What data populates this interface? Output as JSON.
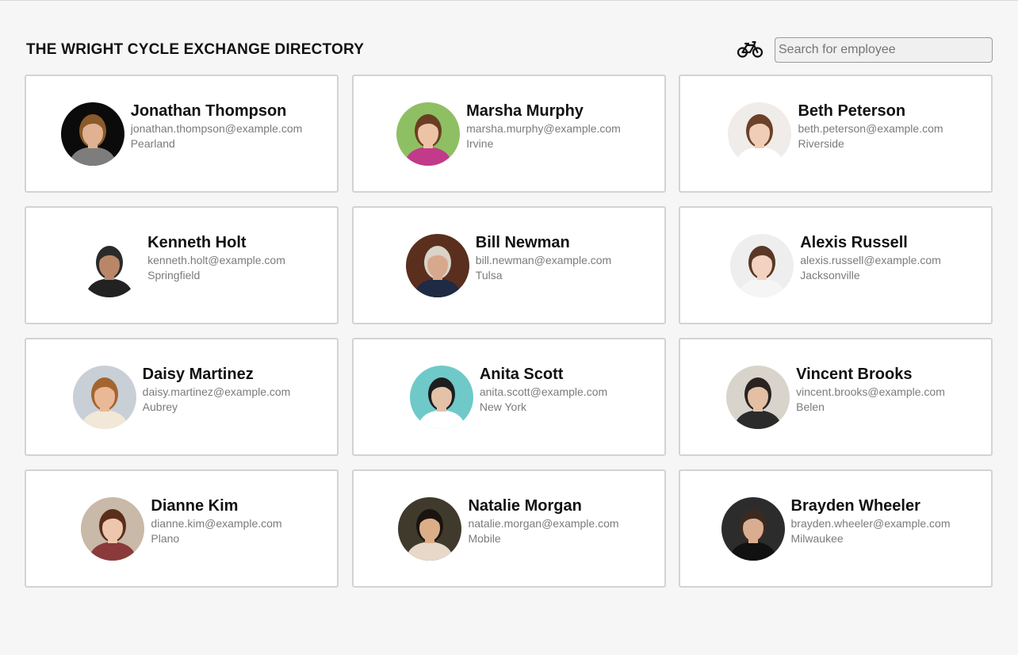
{
  "header": {
    "title": "THE WRIGHT CYCLE EXCHANGE DIRECTORY",
    "logo_icon": "bicycle-icon",
    "search_placeholder": "Search for employee",
    "search_value": ""
  },
  "colors": {
    "background": "#f6f6f6",
    "card_border": "#d3d3d3",
    "secondary_text": "#7b7b7b"
  },
  "employees": [
    {
      "name": "Jonathan Thompson",
      "email": "jonathan.thompson@example.com",
      "city": "Pearland",
      "avatar": {
        "bg": "#0b0b0b",
        "skin": "#e0b291",
        "hair": "#8a5a2b",
        "shirt": "#7d7d7d"
      }
    },
    {
      "name": "Marsha Murphy",
      "email": "marsha.murphy@example.com",
      "city": "Irvine",
      "avatar": {
        "bg": "#8fbf63",
        "skin": "#edc3a5",
        "hair": "#6a3e22",
        "shirt": "#c23a8a"
      }
    },
    {
      "name": "Beth Peterson",
      "email": "beth.peterson@example.com",
      "city": "Riverside",
      "avatar": {
        "bg": "#f0ecea",
        "skin": "#efcdb7",
        "hair": "#6b4128",
        "shirt": "#ffffff"
      }
    },
    {
      "name": "Kenneth Holt",
      "email": "kenneth.holt@example.com",
      "city": "Springfield",
      "avatar": {
        "bg": "#ffffff",
        "skin": "#b98767",
        "hair": "#2a2a2a",
        "shirt": "#222222"
      }
    },
    {
      "name": "Bill Newman",
      "email": "bill.newman@example.com",
      "city": "Tulsa",
      "avatar": {
        "bg": "#5a2f1e",
        "skin": "#d8a88c",
        "hair": "#d9d3c8",
        "shirt": "#1f2a44"
      }
    },
    {
      "name": "Alexis Russell",
      "email": "alexis.russell@example.com",
      "city": "Jacksonville",
      "avatar": {
        "bg": "#eeeeee",
        "skin": "#f2d2c0",
        "hair": "#5a3826",
        "shirt": "#f5f5f5"
      }
    },
    {
      "name": "Daisy Martinez",
      "email": "daisy.martinez@example.com",
      "city": "Aubrey",
      "avatar": {
        "bg": "#c9cfd6",
        "skin": "#e9b897",
        "hair": "#a4652f",
        "shirt": "#f2e8d8"
      }
    },
    {
      "name": "Anita Scott",
      "email": "anita.scott@example.com",
      "city": "New York",
      "avatar": {
        "bg": "#6fc9c9",
        "skin": "#e3c2a8",
        "hair": "#1e1e1e",
        "shirt": "#ffffff"
      }
    },
    {
      "name": "Vincent Brooks",
      "email": "vincent.brooks@example.com",
      "city": "Belen",
      "avatar": {
        "bg": "#d8d4cc",
        "skin": "#e3bfa4",
        "hair": "#2a2320",
        "shirt": "#2b2b2b"
      }
    },
    {
      "name": "Dianne Kim",
      "email": "dianne.kim@example.com",
      "city": "Plano",
      "avatar": {
        "bg": "#c8b9a8",
        "skin": "#eec6ad",
        "hair": "#5b2e1b",
        "shirt": "#8a3a3a"
      }
    },
    {
      "name": "Natalie Morgan",
      "email": "natalie.morgan@example.com",
      "city": "Mobile",
      "avatar": {
        "bg": "#3f3a2c",
        "skin": "#dcae88",
        "hair": "#1a1410",
        "shirt": "#e8d8c8"
      }
    },
    {
      "name": "Brayden Wheeler",
      "email": "brayden.wheeler@example.com",
      "city": "Milwaukee",
      "avatar": {
        "bg": "#2c2c2c",
        "skin": "#d9ad90",
        "hair": "#3a2a20",
        "shirt": "#111111"
      }
    }
  ]
}
